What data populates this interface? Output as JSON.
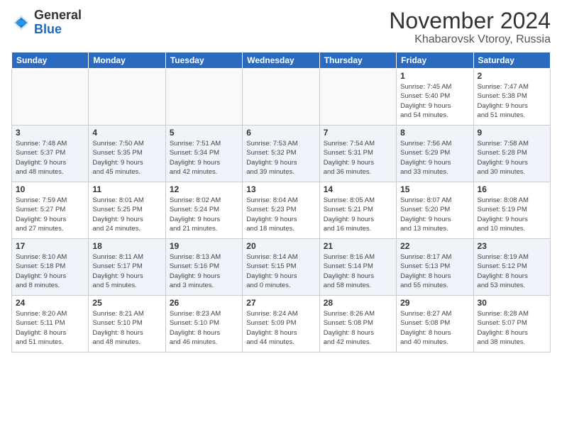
{
  "logo": {
    "general": "General",
    "blue": "Blue"
  },
  "header": {
    "month": "November 2024",
    "location": "Khabarovsk Vtoroy, Russia"
  },
  "weekdays": [
    "Sunday",
    "Monday",
    "Tuesday",
    "Wednesday",
    "Thursday",
    "Friday",
    "Saturday"
  ],
  "weeks": [
    [
      {
        "day": "",
        "info": ""
      },
      {
        "day": "",
        "info": ""
      },
      {
        "day": "",
        "info": ""
      },
      {
        "day": "",
        "info": ""
      },
      {
        "day": "",
        "info": ""
      },
      {
        "day": "1",
        "info": "Sunrise: 7:45 AM\nSunset: 5:40 PM\nDaylight: 9 hours\nand 54 minutes."
      },
      {
        "day": "2",
        "info": "Sunrise: 7:47 AM\nSunset: 5:38 PM\nDaylight: 9 hours\nand 51 minutes."
      }
    ],
    [
      {
        "day": "3",
        "info": "Sunrise: 7:48 AM\nSunset: 5:37 PM\nDaylight: 9 hours\nand 48 minutes."
      },
      {
        "day": "4",
        "info": "Sunrise: 7:50 AM\nSunset: 5:35 PM\nDaylight: 9 hours\nand 45 minutes."
      },
      {
        "day": "5",
        "info": "Sunrise: 7:51 AM\nSunset: 5:34 PM\nDaylight: 9 hours\nand 42 minutes."
      },
      {
        "day": "6",
        "info": "Sunrise: 7:53 AM\nSunset: 5:32 PM\nDaylight: 9 hours\nand 39 minutes."
      },
      {
        "day": "7",
        "info": "Sunrise: 7:54 AM\nSunset: 5:31 PM\nDaylight: 9 hours\nand 36 minutes."
      },
      {
        "day": "8",
        "info": "Sunrise: 7:56 AM\nSunset: 5:29 PM\nDaylight: 9 hours\nand 33 minutes."
      },
      {
        "day": "9",
        "info": "Sunrise: 7:58 AM\nSunset: 5:28 PM\nDaylight: 9 hours\nand 30 minutes."
      }
    ],
    [
      {
        "day": "10",
        "info": "Sunrise: 7:59 AM\nSunset: 5:27 PM\nDaylight: 9 hours\nand 27 minutes."
      },
      {
        "day": "11",
        "info": "Sunrise: 8:01 AM\nSunset: 5:25 PM\nDaylight: 9 hours\nand 24 minutes."
      },
      {
        "day": "12",
        "info": "Sunrise: 8:02 AM\nSunset: 5:24 PM\nDaylight: 9 hours\nand 21 minutes."
      },
      {
        "day": "13",
        "info": "Sunrise: 8:04 AM\nSunset: 5:23 PM\nDaylight: 9 hours\nand 18 minutes."
      },
      {
        "day": "14",
        "info": "Sunrise: 8:05 AM\nSunset: 5:21 PM\nDaylight: 9 hours\nand 16 minutes."
      },
      {
        "day": "15",
        "info": "Sunrise: 8:07 AM\nSunset: 5:20 PM\nDaylight: 9 hours\nand 13 minutes."
      },
      {
        "day": "16",
        "info": "Sunrise: 8:08 AM\nSunset: 5:19 PM\nDaylight: 9 hours\nand 10 minutes."
      }
    ],
    [
      {
        "day": "17",
        "info": "Sunrise: 8:10 AM\nSunset: 5:18 PM\nDaylight: 9 hours\nand 8 minutes."
      },
      {
        "day": "18",
        "info": "Sunrise: 8:11 AM\nSunset: 5:17 PM\nDaylight: 9 hours\nand 5 minutes."
      },
      {
        "day": "19",
        "info": "Sunrise: 8:13 AM\nSunset: 5:16 PM\nDaylight: 9 hours\nand 3 minutes."
      },
      {
        "day": "20",
        "info": "Sunrise: 8:14 AM\nSunset: 5:15 PM\nDaylight: 9 hours\nand 0 minutes."
      },
      {
        "day": "21",
        "info": "Sunrise: 8:16 AM\nSunset: 5:14 PM\nDaylight: 8 hours\nand 58 minutes."
      },
      {
        "day": "22",
        "info": "Sunrise: 8:17 AM\nSunset: 5:13 PM\nDaylight: 8 hours\nand 55 minutes."
      },
      {
        "day": "23",
        "info": "Sunrise: 8:19 AM\nSunset: 5:12 PM\nDaylight: 8 hours\nand 53 minutes."
      }
    ],
    [
      {
        "day": "24",
        "info": "Sunrise: 8:20 AM\nSunset: 5:11 PM\nDaylight: 8 hours\nand 51 minutes."
      },
      {
        "day": "25",
        "info": "Sunrise: 8:21 AM\nSunset: 5:10 PM\nDaylight: 8 hours\nand 48 minutes."
      },
      {
        "day": "26",
        "info": "Sunrise: 8:23 AM\nSunset: 5:10 PM\nDaylight: 8 hours\nand 46 minutes."
      },
      {
        "day": "27",
        "info": "Sunrise: 8:24 AM\nSunset: 5:09 PM\nDaylight: 8 hours\nand 44 minutes."
      },
      {
        "day": "28",
        "info": "Sunrise: 8:26 AM\nSunset: 5:08 PM\nDaylight: 8 hours\nand 42 minutes."
      },
      {
        "day": "29",
        "info": "Sunrise: 8:27 AM\nSunset: 5:08 PM\nDaylight: 8 hours\nand 40 minutes."
      },
      {
        "day": "30",
        "info": "Sunrise: 8:28 AM\nSunset: 5:07 PM\nDaylight: 8 hours\nand 38 minutes."
      }
    ]
  ]
}
